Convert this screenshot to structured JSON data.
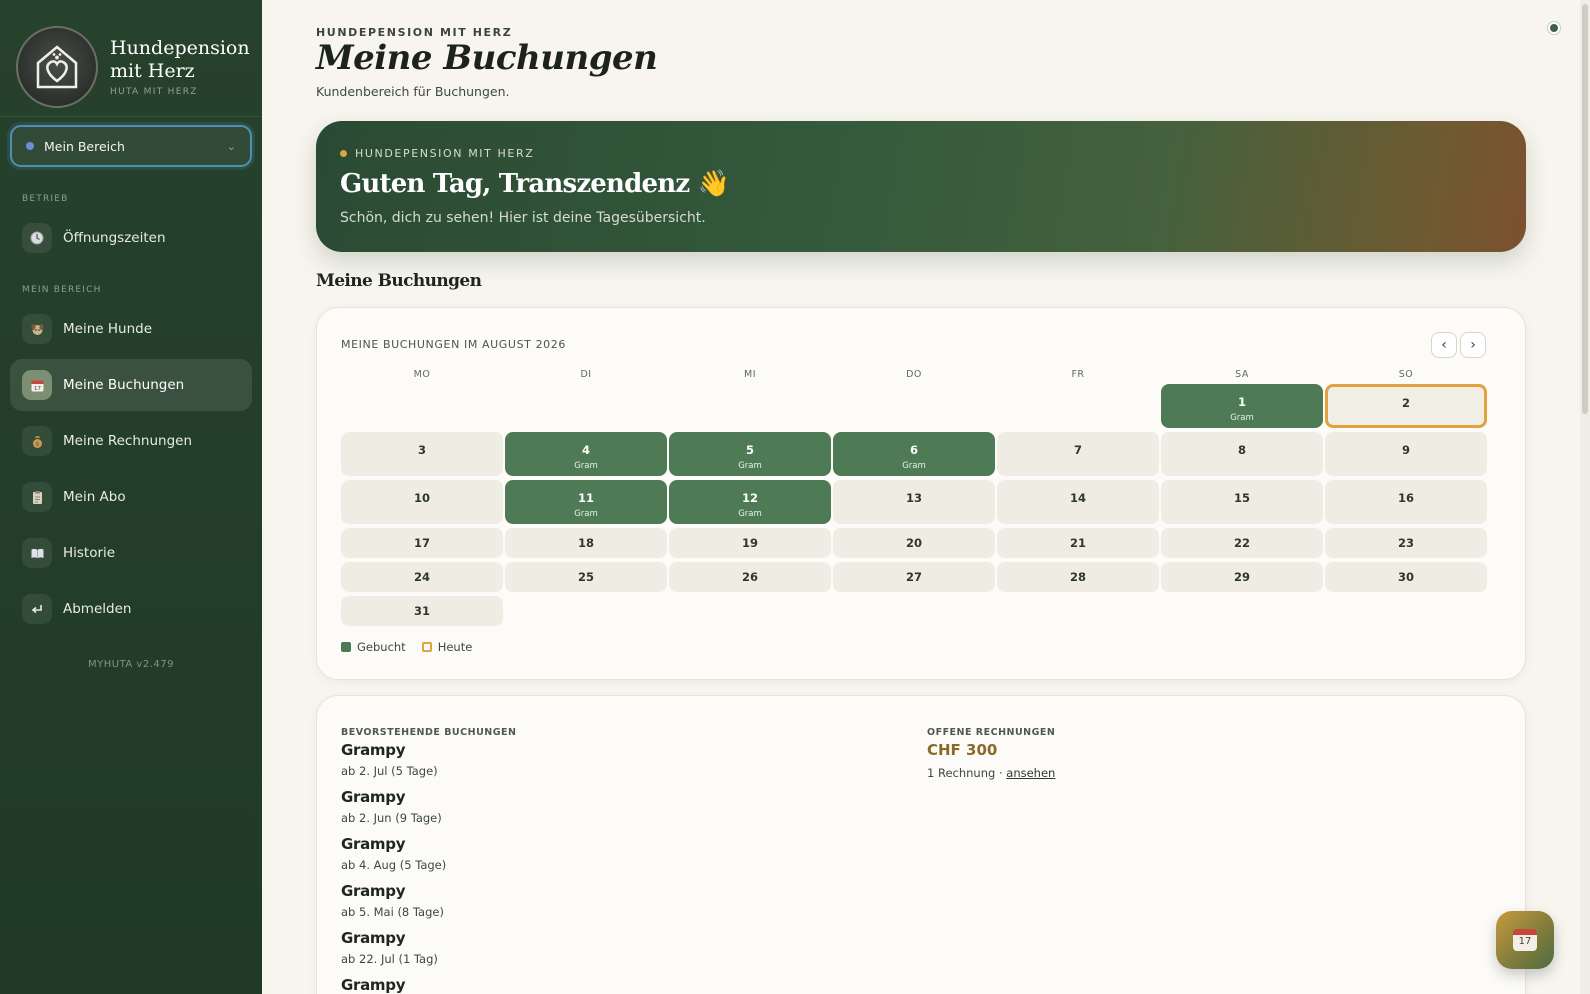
{
  "brand": {
    "title_line1": "Hundepension",
    "title_line2": "mit Herz",
    "subtitle": "HUTA MIT HERZ"
  },
  "area_select": {
    "value": "Mein Bereich"
  },
  "sidebar": {
    "section_betrieb": "BETRIEB",
    "section_mein_bereich": "MEIN BEREICH",
    "items": [
      {
        "label": "Öffnungszeiten",
        "icon": "clock-icon"
      },
      {
        "label": "Meine Hunde",
        "icon": "dog-icon"
      },
      {
        "label": "Meine Buchungen",
        "icon": "calendar-icon",
        "active": true
      },
      {
        "label": "Meine Rechnungen",
        "icon": "money-bag-icon"
      },
      {
        "label": "Mein Abo",
        "icon": "clipboard-icon"
      },
      {
        "label": "Historie",
        "icon": "book-icon"
      },
      {
        "label": "Abmelden",
        "icon": "logout-arrow-icon"
      }
    ],
    "version": "MYHUTA v2.479"
  },
  "header": {
    "eyebrow": "HUNDEPENSION MIT HERZ",
    "title": "Meine Buchungen",
    "subtitle": "Kundenbereich für Buchungen."
  },
  "hero": {
    "eyebrow": "HUNDEPENSION MIT HERZ",
    "title": "Guten Tag, Transzendenz 👋",
    "subtitle": "Schön, dich zu sehen! Hier ist deine Tagesübersicht."
  },
  "section_title": "Meine Buchungen",
  "calendar": {
    "heading": "MEINE BUCHUNGEN IM AUGUST 2026",
    "prev": "‹",
    "next": "›",
    "weekdays": [
      "MO",
      "DI",
      "MI",
      "DO",
      "FR",
      "SA",
      "SO"
    ],
    "booked_label": "Gram",
    "days": [
      {
        "n": "1",
        "booked": true
      },
      {
        "n": "2",
        "today": true
      },
      {
        "n": "3"
      },
      {
        "n": "4",
        "booked": true
      },
      {
        "n": "5",
        "booked": true
      },
      {
        "n": "6",
        "booked": true
      },
      {
        "n": "7"
      },
      {
        "n": "8"
      },
      {
        "n": "9"
      },
      {
        "n": "10"
      },
      {
        "n": "11",
        "booked": true
      },
      {
        "n": "12",
        "booked": true
      },
      {
        "n": "13"
      },
      {
        "n": "14"
      },
      {
        "n": "15"
      },
      {
        "n": "16"
      },
      {
        "n": "17"
      },
      {
        "n": "18"
      },
      {
        "n": "19"
      },
      {
        "n": "20"
      },
      {
        "n": "21"
      },
      {
        "n": "22"
      },
      {
        "n": "23"
      },
      {
        "n": "24"
      },
      {
        "n": "25"
      },
      {
        "n": "26"
      },
      {
        "n": "27"
      },
      {
        "n": "28"
      },
      {
        "n": "29"
      },
      {
        "n": "30"
      },
      {
        "n": "31"
      }
    ],
    "legend_booked": "Gebucht",
    "legend_today": "Heute"
  },
  "upcoming": {
    "label": "BEVORSTEHENDE BUCHUNGEN",
    "items": [
      {
        "name": "Grampy",
        "date": "ab 2. Jul (5 Tage)"
      },
      {
        "name": "Grampy",
        "date": "ab 2. Jun (9 Tage)"
      },
      {
        "name": "Grampy",
        "date": "ab 4. Aug (5 Tage)"
      },
      {
        "name": "Grampy",
        "date": "ab 5. Mai (8 Tage)"
      },
      {
        "name": "Grampy",
        "date": "ab 22. Jul (1 Tag)"
      },
      {
        "name": "Grampy",
        "date": ""
      }
    ]
  },
  "invoices": {
    "label": "OFFENE RECHNUNGEN",
    "amount": "CHF 300",
    "meta": "1 Rechnung · ",
    "link": "ansehen"
  },
  "fab": {
    "icon": "calendar-17-icon",
    "label": "17"
  },
  "colors": {
    "sidebar": "#26412c",
    "booked": "#4e7a55",
    "today_border": "#e2a23f",
    "invoice_amount": "#8a6a2a"
  }
}
